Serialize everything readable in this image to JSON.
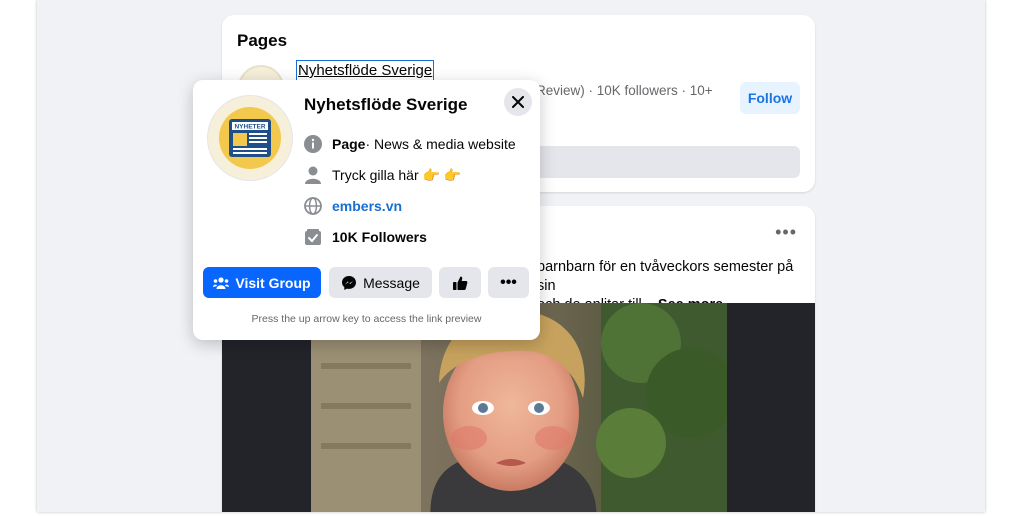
{
  "pages_section": {
    "title": "Pages",
    "page_link": "Nyhetsflöde Sverige",
    "meta": "Review) · 10K followers · 10+",
    "follow_label": "Follow"
  },
  "post": {
    "more_label": "•••",
    "text_line1": "barnbarn för en tvåveckors semester på sin",
    "text_line2": "och de anlitar till...",
    "see_more": "See more"
  },
  "hover_card": {
    "name": "Nyhetsflöde Sverige",
    "logo_text": "NYHETER",
    "type_label": "Page",
    "type_rest": " · News & media website",
    "intro": "Tryck gilla här 👉 👉",
    "website": "embers.vn",
    "followers": "10K Followers",
    "visit_label": "Visit Group",
    "message_label": "Message",
    "more_label": "•••",
    "hint": "Press the up arrow key to access the link preview"
  },
  "colors": {
    "accent": "#0866ff",
    "follow_text": "#1b74e4",
    "link": "#1b6ed0",
    "logo_blue": "#1f4f8a",
    "logo_yellow": "#f2c94c"
  }
}
